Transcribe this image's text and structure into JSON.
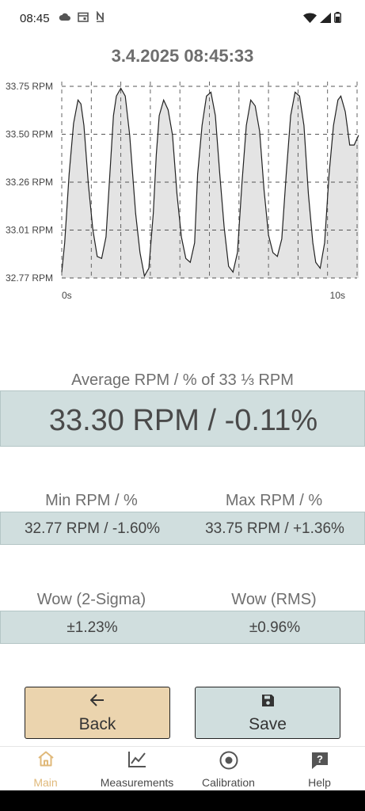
{
  "status_bar": {
    "time": "08:45",
    "left_icons": [
      "cloud-icon",
      "calendar-icon",
      "nfc-icon"
    ],
    "right_icons": [
      "wifi-icon",
      "signal-icon",
      "battery-icon"
    ]
  },
  "header": {
    "timestamp": "3.4.2025 08:45:33"
  },
  "chart_data": {
    "type": "line",
    "title": "",
    "xlabel": "",
    "ylabel": "",
    "x_tick_labels": [
      "0s",
      "10s"
    ],
    "y_tick_labels": [
      "33.75 RPM",
      "33.50 RPM",
      "33.26 RPM",
      "33.01 RPM",
      "32.77 RPM"
    ],
    "xlim": [
      0,
      10
    ],
    "ylim": [
      32.77,
      33.75
    ],
    "grid": true,
    "fill": "#e4e4e4",
    "line_color": "#222222",
    "series": [
      {
        "x": [
          0,
          0.1,
          0.25,
          0.4,
          0.55,
          0.65,
          0.75,
          0.9,
          1.05,
          1.2,
          1.35,
          1.5,
          1.65,
          1.75,
          1.85,
          2.0,
          2.15,
          2.3,
          2.5,
          2.65,
          2.8,
          2.95,
          3.1,
          3.2,
          3.3,
          3.45,
          3.6,
          3.75,
          3.9,
          4.05,
          4.2,
          4.35,
          4.5,
          4.6,
          4.75,
          4.9,
          5.05,
          5.2,
          5.35,
          5.5,
          5.65,
          5.8,
          5.95,
          6.1,
          6.25,
          6.4,
          6.55,
          6.7,
          6.85,
          7.0,
          7.15,
          7.3,
          7.45,
          7.6,
          7.75,
          7.9,
          8.05,
          8.2,
          8.35,
          8.5,
          8.6,
          8.75,
          8.9,
          9.05,
          9.2,
          9.35,
          9.45,
          9.6,
          9.75,
          9.9,
          10.05
        ],
        "y": [
          32.8,
          32.95,
          33.3,
          33.56,
          33.68,
          33.66,
          33.55,
          33.25,
          33.02,
          32.88,
          32.87,
          32.98,
          33.35,
          33.6,
          33.7,
          33.74,
          33.7,
          33.5,
          33.1,
          32.9,
          32.78,
          32.82,
          33.1,
          33.4,
          33.6,
          33.68,
          33.63,
          33.5,
          33.2,
          32.98,
          32.87,
          32.85,
          32.95,
          33.3,
          33.55,
          33.7,
          33.72,
          33.6,
          33.3,
          33.03,
          32.83,
          32.8,
          32.9,
          33.25,
          33.55,
          33.68,
          33.65,
          33.52,
          33.22,
          32.99,
          32.9,
          32.88,
          32.97,
          33.3,
          33.6,
          33.72,
          33.7,
          33.55,
          33.2,
          32.95,
          32.85,
          32.82,
          32.95,
          33.3,
          33.55,
          33.68,
          33.7,
          33.62,
          33.45,
          33.45,
          33.5
        ]
      }
    ]
  },
  "average": {
    "label": "Average RPM / % of 33 ⅓ RPM",
    "value": "33.30 RPM / -0.11%"
  },
  "minmax": {
    "min_label": "Min RPM / %",
    "max_label": "Max RPM / %",
    "min_value": "32.77 RPM / -1.60%",
    "max_value": "33.75 RPM / +1.36%"
  },
  "wow": {
    "sigma_label": "Wow (2-Sigma)",
    "rms_label": "Wow (RMS)",
    "sigma_value": "±1.23%",
    "rms_value": "±0.96%"
  },
  "buttons": {
    "back_label": "Back",
    "save_label": "Save",
    "back_color": "#ebd4ae",
    "save_color": "#d0dede"
  },
  "nav": {
    "active_color": "#e0b97a",
    "items": [
      {
        "label": "Main",
        "icon": "home-icon"
      },
      {
        "label": "Measurements",
        "icon": "chart-icon"
      },
      {
        "label": "Calibration",
        "icon": "target-icon"
      },
      {
        "label": "Help",
        "icon": "help-icon"
      }
    ]
  }
}
